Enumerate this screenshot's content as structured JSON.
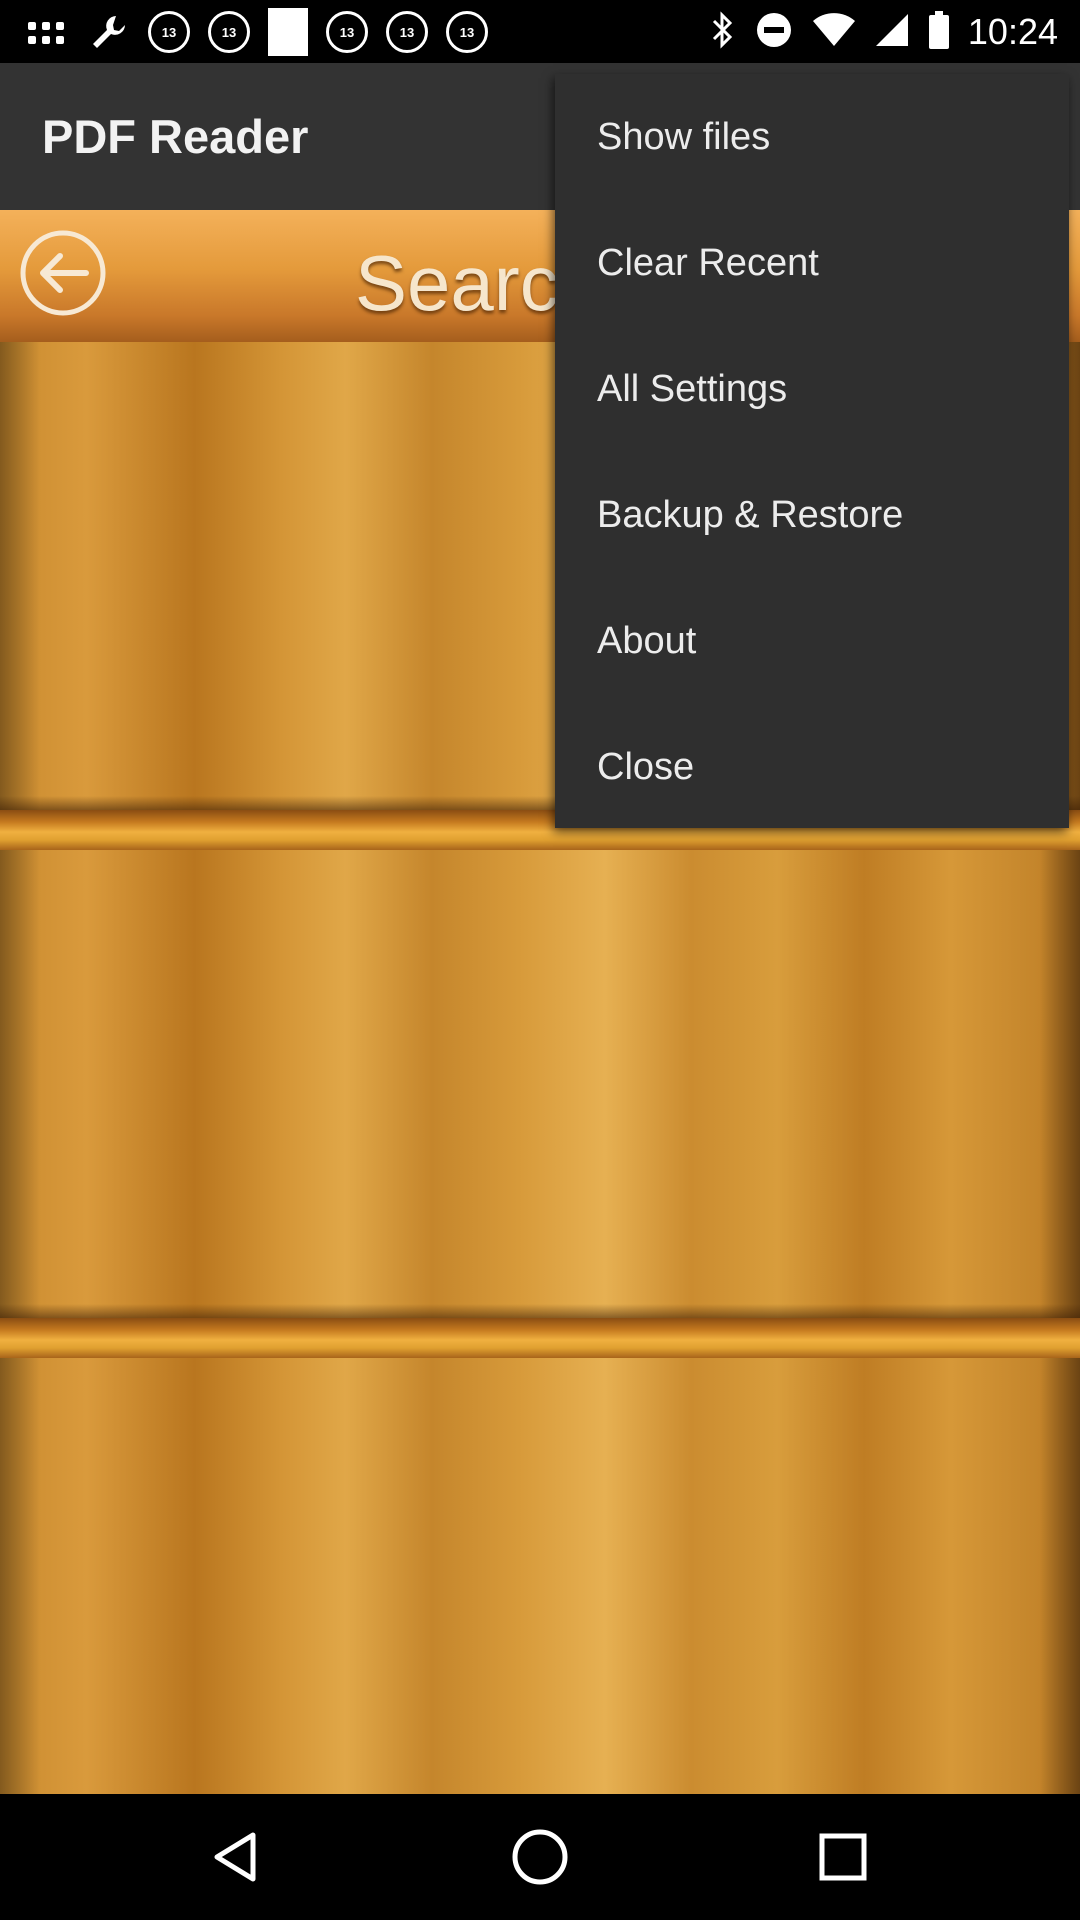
{
  "status_bar": {
    "time": "10:24",
    "notification_icons": [
      "app-grid-icon",
      "wrench-icon",
      "abc13-icon",
      "abc13-icon",
      "image-icon",
      "abc13-icon",
      "abc13-icon",
      "abc13-icon"
    ],
    "abc_label": "13",
    "right_icons": [
      "bluetooth-icon",
      "do-not-disturb-icon",
      "wifi-icon",
      "signal-icon",
      "battery-icon"
    ]
  },
  "app_bar": {
    "title": "PDF Reader"
  },
  "toolbar": {
    "back_icon": "back-arrow-icon",
    "search_label": "Searc"
  },
  "menu": {
    "items": [
      {
        "label": "Show files"
      },
      {
        "label": "Clear Recent"
      },
      {
        "label": "All Settings"
      },
      {
        "label": "Backup & Restore"
      },
      {
        "label": "About"
      },
      {
        "label": "Close"
      }
    ]
  },
  "nav_bar": {
    "icons": [
      "back-triangle-icon",
      "home-circle-icon",
      "recents-square-icon"
    ]
  },
  "colors": {
    "app_bar": "#333333",
    "menu_bg": "#2f2f2f",
    "wood": "#d49536",
    "shelf_edge": "#f0b040"
  }
}
